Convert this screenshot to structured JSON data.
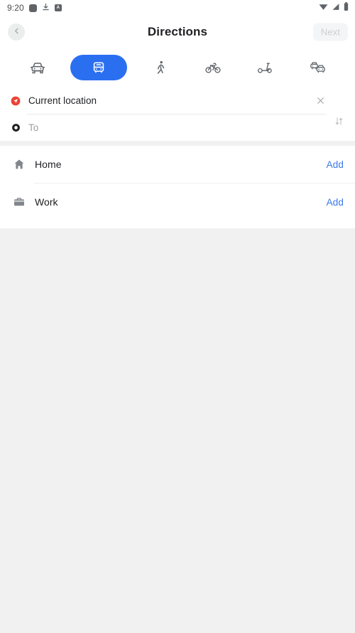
{
  "status_bar": {
    "time": "9:20",
    "left_icons": [
      "rounded-square-icon",
      "download-icon",
      "app-badge-icon"
    ],
    "badge_letter": "A",
    "right_icons": [
      "wifi-icon",
      "signal-icon",
      "battery-icon"
    ]
  },
  "header": {
    "back_icon": "chevron-left-icon",
    "title": "Directions",
    "next_label": "Next",
    "next_enabled": false
  },
  "modes": {
    "selected_index": 1,
    "accent_color": "#2a6ff0",
    "items": [
      {
        "icon": "car-icon",
        "label": "Driving",
        "selected": false
      },
      {
        "icon": "bus-icon",
        "label": "Transit",
        "selected": true
      },
      {
        "icon": "walk-icon",
        "label": "Walking",
        "selected": false
      },
      {
        "icon": "bicycle-icon",
        "label": "Cycling",
        "selected": false
      },
      {
        "icon": "scooter-icon",
        "label": "Scooter",
        "selected": false
      },
      {
        "icon": "rideshare-icon",
        "label": "Rideshare",
        "selected": false
      }
    ]
  },
  "route_inputs": {
    "origin": {
      "icon": "navigation-arrow-icon",
      "icon_color": "#ea4335",
      "value": "Current location",
      "clear_icon": "close-icon"
    },
    "destination": {
      "icon": "destination-ring-icon",
      "icon_color": "#202124",
      "value": "",
      "placeholder": "To"
    },
    "swap_icon": "swap-vertical-icon"
  },
  "saved_places": {
    "items": [
      {
        "icon": "home-icon",
        "label": "Home",
        "action_label": "Add"
      },
      {
        "icon": "briefcase-icon",
        "label": "Work",
        "action_label": "Add"
      }
    ],
    "action_color": "#3b78e7"
  }
}
